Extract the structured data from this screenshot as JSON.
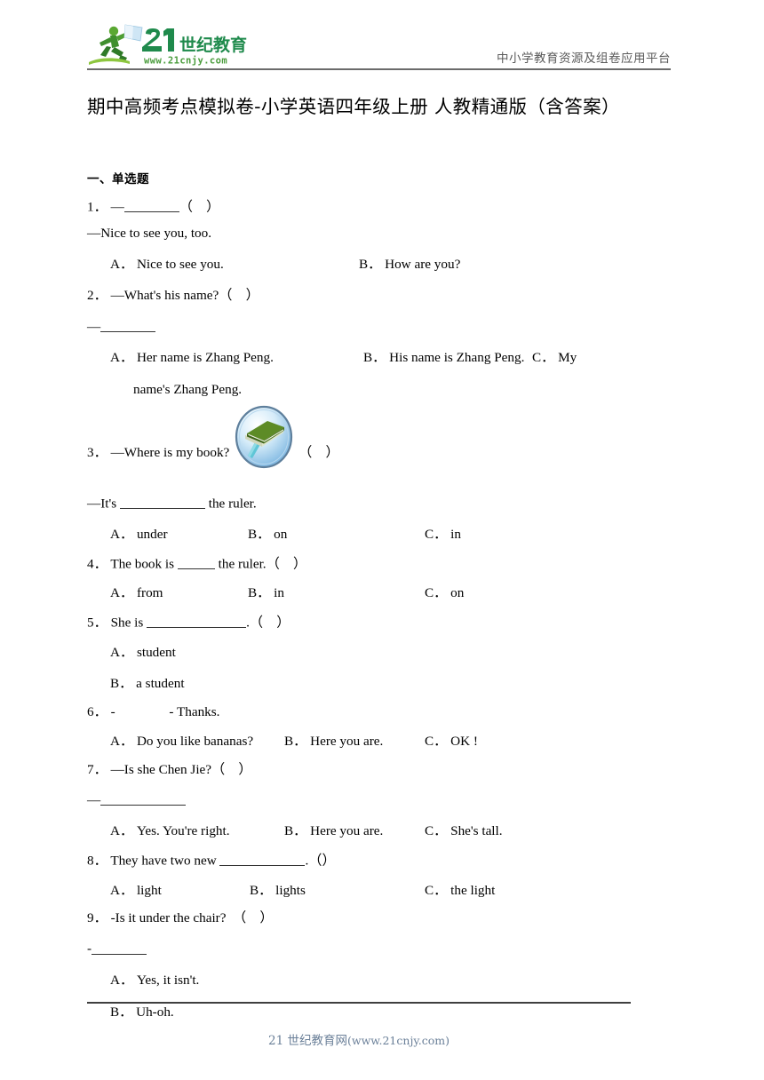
{
  "header": {
    "logo_text_main": "21世纪教育",
    "logo_text_sub": "www.21cnjy.com",
    "tagline": "中小学教育资源及组卷应用平台",
    "logo_green": "#3a8a3f",
    "logo_dark_green": "#1f7a4d",
    "rule_color": "#6b6b6b"
  },
  "title": "期中高频考点模拟卷-小学英语四年级上册 人教精通版（含答案）",
  "section": {
    "heading": "一、单选题"
  },
  "questions": [
    {
      "number": "1．",
      "stem_pre": "—",
      "stem_post": "（　）",
      "stem_blank": "medium",
      "line2": "—Nice to see you, too.",
      "options": [
        {
          "label": "A．",
          "text": "Nice to see you."
        },
        {
          "label": "B．",
          "text": "How are you?"
        }
      ]
    },
    {
      "number": "2．",
      "stem": "—What's his name?（　）",
      "line2_pre": "—",
      "line2_blank": "medium",
      "options": [
        {
          "label": "A．",
          "text": "Her name is Zhang Peng."
        },
        {
          "label": "B．",
          "text": "His name is Zhang Peng."
        },
        {
          "label": "C．",
          "text": "My"
        }
      ],
      "wrap_text": "name's Zhang Peng."
    },
    {
      "number": "3．",
      "stem": "—Where is my book?",
      "stem_tail": "（　）",
      "icon": "book-on-ruler-icon",
      "line2_pre": "—It's",
      "line2_post": "the ruler.",
      "options": [
        {
          "label": "A．",
          "text": "under"
        },
        {
          "label": "B．",
          "text": "on"
        },
        {
          "label": "C．",
          "text": "in"
        }
      ]
    },
    {
      "number": "4．",
      "stem_pre": "The book is",
      "stem_post": "the ruler.（　）",
      "options": [
        {
          "label": "A．",
          "text": "from"
        },
        {
          "label": "B．",
          "text": "in"
        },
        {
          "label": "C．",
          "text": "on"
        }
      ]
    },
    {
      "number": "5．",
      "stem_pre": "She is",
      "stem_post": ".（　）",
      "options": [
        {
          "label": "A．",
          "text": "student"
        },
        {
          "label": "B．",
          "text": "a student"
        }
      ]
    },
    {
      "number": "6．",
      "stem": "-                - Thanks.",
      "options": [
        {
          "label": "A．",
          "text": "Do you like bananas?"
        },
        {
          "label": "B．",
          "text": "Here you are."
        },
        {
          "label": "C．",
          "text": "OK !"
        }
      ]
    },
    {
      "number": "7．",
      "stem": "—Is she Chen Jie?（　）",
      "line2_pre": "—",
      "options": [
        {
          "label": "A．",
          "text": "Yes. You're right."
        },
        {
          "label": "B．",
          "text": "Here you are."
        },
        {
          "label": "C．",
          "text": "She's tall."
        }
      ]
    },
    {
      "number": "8．",
      "stem_pre": "They have two new",
      "stem_post": ".（）",
      "options": [
        {
          "label": "A．",
          "text": "light"
        },
        {
          "label": "B．",
          "text": "lights"
        },
        {
          "label": "C．",
          "text": "the light"
        }
      ]
    },
    {
      "number": "9．",
      "stem": "-Is it under the chair?　（　）",
      "line2_pre": "-",
      "options": [
        {
          "label": "A．",
          "text": "Yes, it isn't."
        },
        {
          "label": "B．",
          "text": "Uh-oh."
        }
      ]
    }
  ],
  "footer": {
    "cn": "21 世纪教育网",
    "en": "(www.21cnjy.com)",
    "color": "#6b8099"
  }
}
